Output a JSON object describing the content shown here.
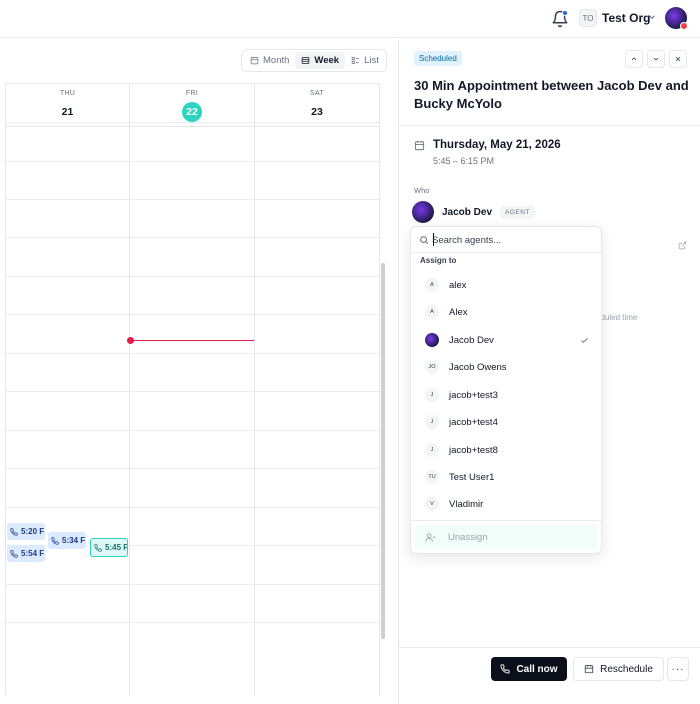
{
  "topbar": {
    "org_initials": "TO",
    "org_name": "Test Org"
  },
  "calendar": {
    "views": [
      "Month",
      "Week",
      "List"
    ],
    "active_view": "Week",
    "days": [
      {
        "dow": "",
        "num": ""
      },
      {
        "dow": "THU",
        "num": "21"
      },
      {
        "dow": "FRI",
        "num": "22",
        "today": true
      },
      {
        "dow": "SAT",
        "num": "23"
      }
    ],
    "events": [
      {
        "label": "5:20 F"
      },
      {
        "label": "5:54 F"
      },
      {
        "label": "5:34 F"
      },
      {
        "label": "5:45 F",
        "selected": true
      }
    ]
  },
  "panel": {
    "status": "Scheduled",
    "title": "30 Min Appointment between Jacob Dev and Bucky McYolo",
    "date": "Thursday, May 21, 2026",
    "time": "5:45 – 6:15 PM",
    "who_label": "Who",
    "agent_name": "Jacob Dev",
    "agent_tag": "AGENT",
    "background_text": "eduled time",
    "call_now": "Call now",
    "reschedule": "Reschedule",
    "more": "···"
  },
  "dropdown": {
    "search_placeholder": "Search agents...",
    "heading": "Assign to",
    "items": [
      {
        "initials": "A",
        "label": "alex"
      },
      {
        "initials": "A",
        "label": "Alex"
      },
      {
        "initials": "",
        "label": "Jacob Dev",
        "selected": true,
        "avatar": true
      },
      {
        "initials": "JO",
        "label": "Jacob Owens"
      },
      {
        "initials": "J",
        "label": "jacob+test3"
      },
      {
        "initials": "J",
        "label": "jacob+test4"
      },
      {
        "initials": "J",
        "label": "jacob+test8"
      },
      {
        "initials": "TU",
        "label": "Test User1"
      },
      {
        "initials": "V",
        "label": "Vladimir"
      }
    ],
    "unassign": "Unassign"
  },
  "colors": {
    "accent": "#2dd4bf",
    "now_line": "#e11d48",
    "status_bg": "#e0f2fe",
    "primary_button": "#0b0f19"
  }
}
